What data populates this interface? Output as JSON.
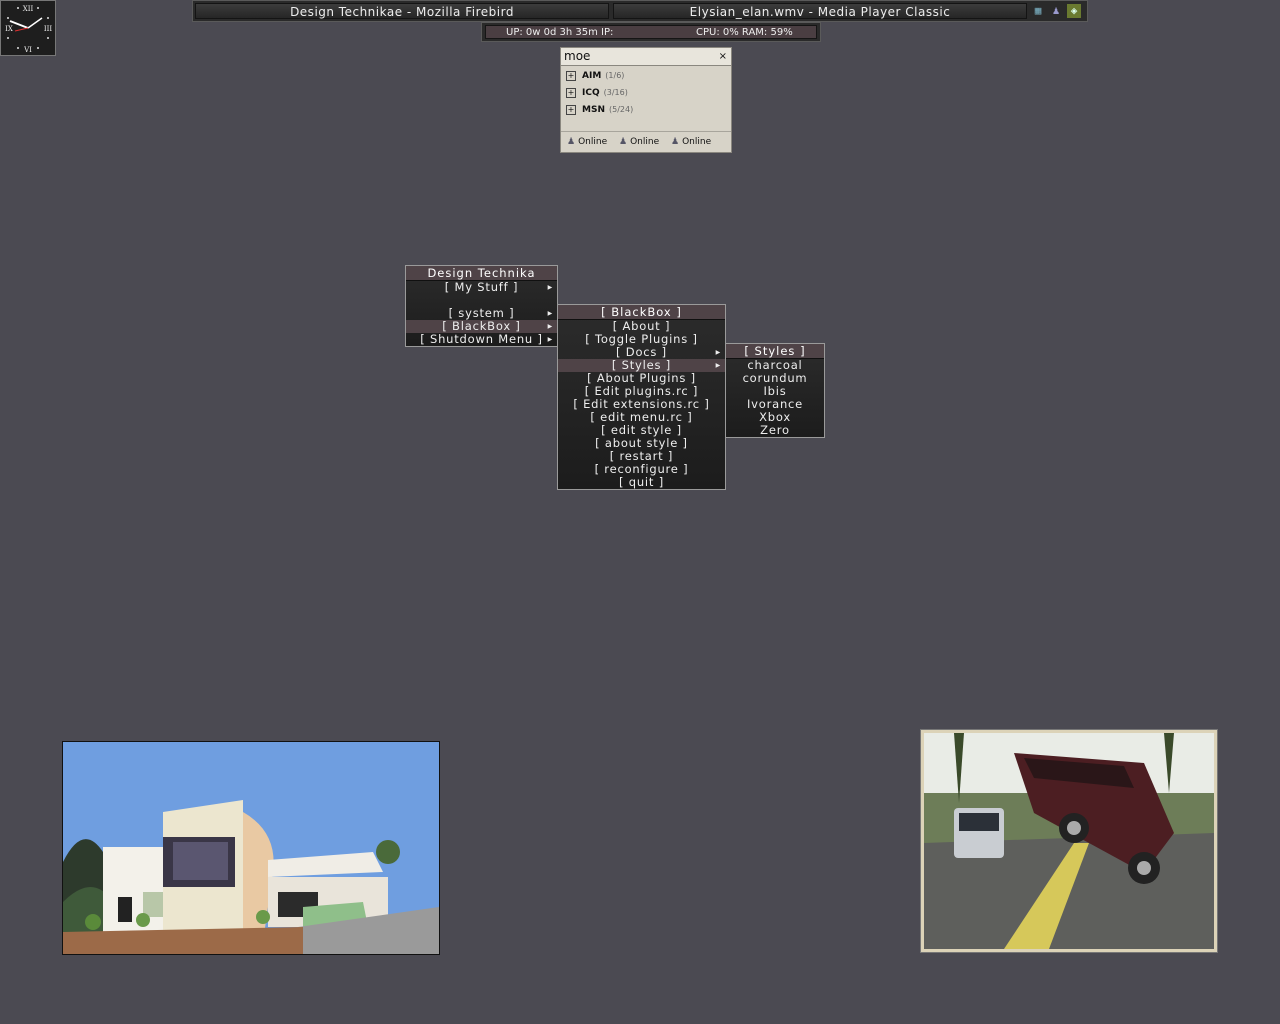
{
  "clock": {
    "numerals": [
      "XII",
      "III",
      "VI",
      "IX"
    ]
  },
  "taskbar": {
    "tasks": [
      {
        "label": "Design Technikae - Mozilla Firebird"
      },
      {
        "label": "Elysian_elan.wmv - Media Player Classic"
      }
    ],
    "tray_icons": [
      "network-icon",
      "messenger-icon",
      "display-icon"
    ]
  },
  "sysbar": {
    "uptime": "UP: 0w 0d 3h 35m IP:",
    "usage": "CPU: 0% RAM: 59%"
  },
  "buddy_list": {
    "title": "moe",
    "close": "×",
    "groups": [
      {
        "name": "AIM",
        "count": "(1/6)"
      },
      {
        "name": "ICQ",
        "count": "(3/16)"
      },
      {
        "name": "MSN",
        "count": "(5/24)"
      }
    ],
    "statuses": [
      "Online",
      "Online",
      "Online"
    ]
  },
  "menus": {
    "root": {
      "title": "Design Technika",
      "items": [
        "[ My Stuff ]",
        "",
        "[ system ]",
        "[ BlackBox ]",
        "[ Shutdown Menu ]"
      ]
    },
    "blackbox": {
      "title": "[ BlackBox ]",
      "items": [
        "[ About ]",
        "[ Toggle Plugins ]",
        "[ Docs ]",
        "[ Styles ]",
        "[ About Plugins ]",
        "[ Edit plugins.rc ]",
        "[ Edit extensions.rc ]",
        "[ edit menu.rc ]",
        "[ edit style ]",
        "[ about style ]",
        "[ restart ]",
        "[ reconfigure ]",
        "[ quit ]"
      ]
    },
    "styles": {
      "title": "[ Styles ]",
      "items": [
        "charcoal",
        "corundum",
        "Ibis",
        "Ivorance",
        "Xbox",
        "Zero"
      ]
    }
  },
  "colors": {
    "desktop": "#4b4a52",
    "menu_highlight": "#4f4347",
    "buddy_bg": "#d7d3c8"
  }
}
